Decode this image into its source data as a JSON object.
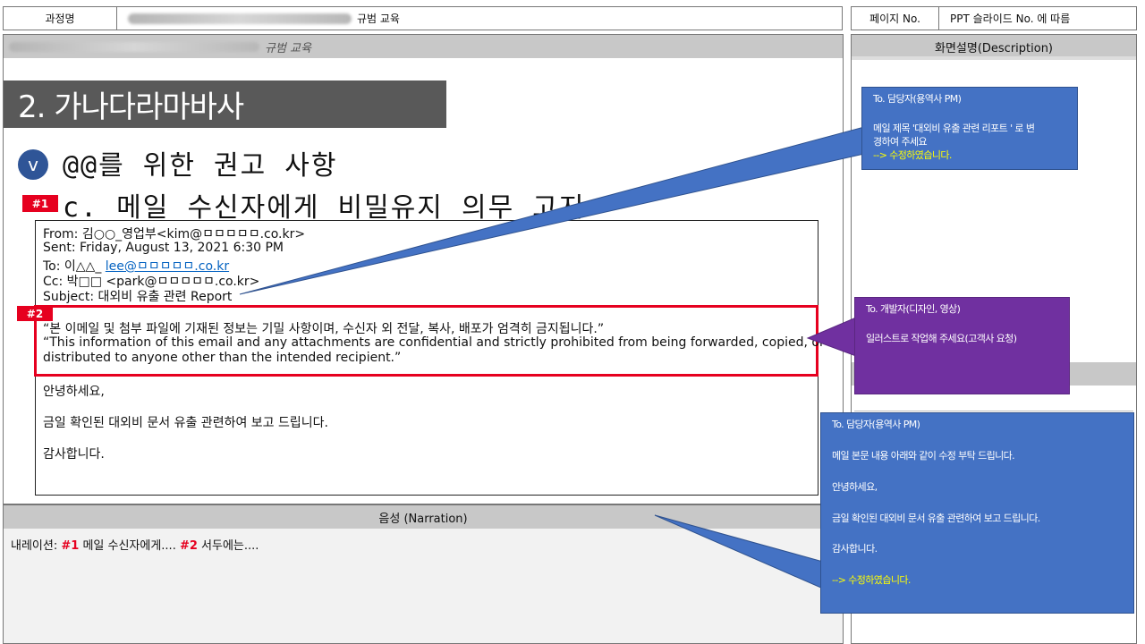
{
  "header": {
    "course_label": "과정명",
    "course_suffix": "규범 교육",
    "page_label": "페이지 No.",
    "page_value": "PPT 슬라이드 No. 에 따름"
  },
  "slide": {
    "header_suffix": "규범 교육",
    "title": "2. 가나다라마바사",
    "bullet_icon": "v",
    "heading1": "@@를 위한 권고 사항",
    "heading2": "c. 메일 수신자에게 비밀유지 의무 고지",
    "tag1": "#1",
    "tag2": "#2",
    "email": {
      "from": "From: 김○○_영업부<kim@ㅁㅁㅁㅁㅁ.co.kr>",
      "sent": "Sent: Friday, August 13, 2021 6:30 PM",
      "to_prefix": "To: 이△△_ ",
      "to_link": "lee@ㅁㅁㅁㅁㅁ.co.kr",
      "cc": "Cc: 박□□ <park@ㅁㅁㅁㅁㅁ.co.kr>",
      "subject": "Subject: 대외비 유출 관련 Report",
      "notice_ko": "“본 이메일 및 첨부 파일에 기재된 정보는 기밀 사항이며, 수신자 외 전달, 복사, 배포가 엄격히 금지됩니다.”",
      "notice_en1": "“This information of this email and any attachments are confidential and strictly prohibited from being forwarded, copied, or",
      "notice_en2": "distributed to anyone other than the intended recipient.”",
      "greeting": "안녕하세요,",
      "body": "금일 확인된 대외비 문서 유출 관련하여 보고 드립니다.",
      "closing": "감사합니다."
    }
  },
  "description": {
    "header": "화면설명(Description)"
  },
  "narration": {
    "header": "음성 (Narration)",
    "prefix": "내레이션: ",
    "tag1": "#1",
    "text1": " 메일 수신자에게.... ",
    "tag2": "#2",
    "text2": " 서두에는...."
  },
  "callouts": {
    "c1": {
      "to": "To. 담당자(용역사 PM)",
      "line1": "메일 제목 '대외비 유출 관련 리포트 ' 로 변",
      "line2": "경하여 주세요",
      "done": "--> 수정하였습니다."
    },
    "c2": {
      "to": "To. 개발자(디자인, 영상)",
      "line1": "일러스트로  작업해 주세요(고객사 요청)"
    },
    "c3": {
      "to": "To. 담당자(용역사 PM)",
      "line1": "메일 본문 내용  아래와 같이 수정 부탁 드립니다.",
      "line2": "안녕하세요,",
      "line3": "금일 확인된 대외비 문서 유출 관련하여 보고 드립니다.",
      "line4": "감사합니다.",
      "done": "--> 수정하였습니다."
    }
  },
  "colors": {
    "accent_red": "#e6001f",
    "callout_blue": "#4472c4",
    "callout_purple": "#7030a0",
    "title_bar": "#595959",
    "bullet_blue": "#2f5597"
  }
}
